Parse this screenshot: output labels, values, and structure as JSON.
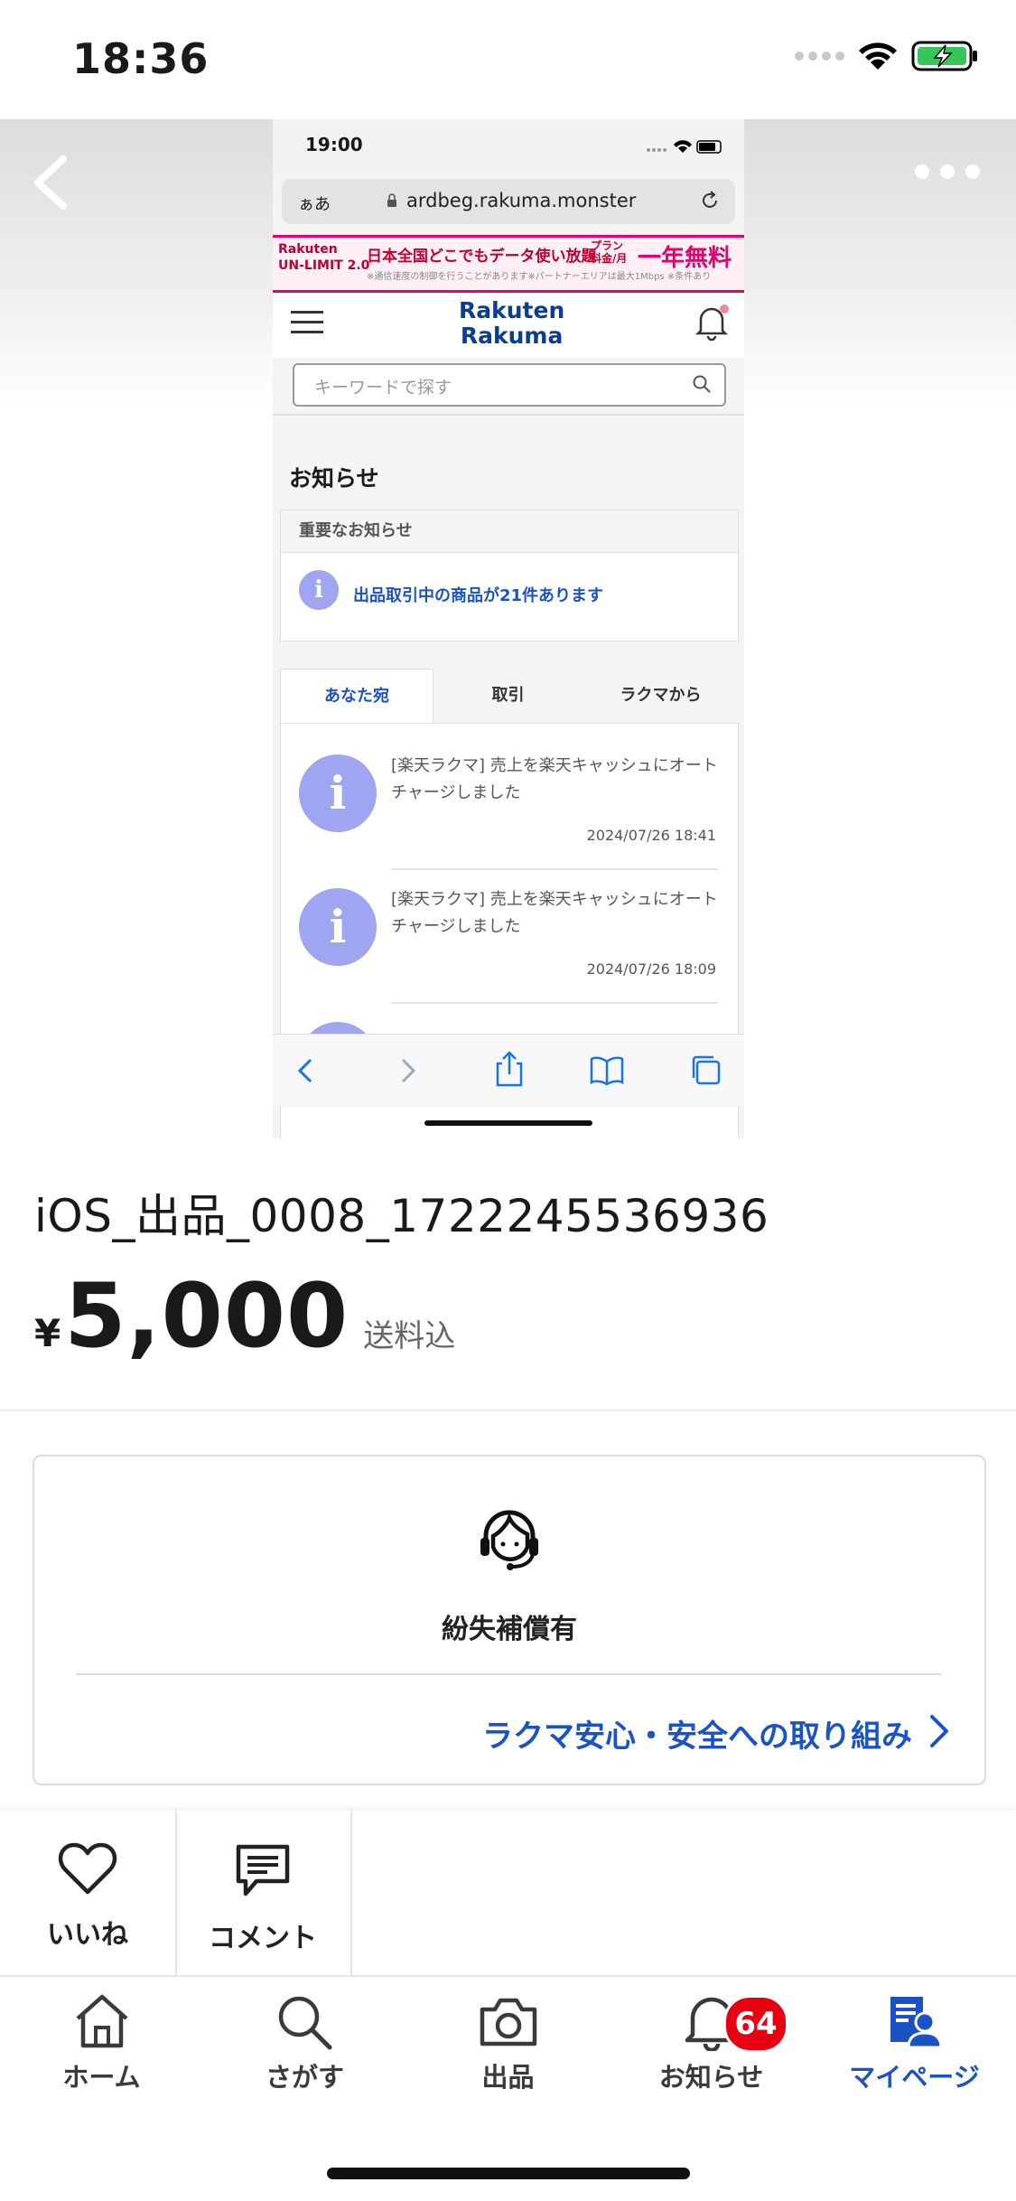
{
  "status_bar": {
    "time": "18:36"
  },
  "hero": {
    "screenshot": {
      "time": "19:00",
      "url_prefix": "ぁあ",
      "url": "ardbeg.rakuma.monster",
      "ad": {
        "brand_line1": "Rakuten",
        "brand_line2": "UN-LIMIT 2.0",
        "main": "日本全国どこでもデータ使い放題",
        "plan_line1": "プラン",
        "plan_line2": "料金/月",
        "big": "一年無料",
        "fineprint": "※通信速度の制御を行うことがあります※パートナーエリアは最大1Mbps ※条件あり"
      },
      "logo_line1": "Rakuten",
      "logo_line2": "Rakuma",
      "search_placeholder": "キーワードで探す",
      "page_title": "お知らせ",
      "important_header": "重要なお知らせ",
      "important_text": "出品取引中の商品が21件あります",
      "tabs": [
        "あなた宛",
        "取引",
        "ラクマから"
      ],
      "notifications": [
        {
          "line1": "[楽天ラクマ] 売上を楽天キャッシュにオート",
          "line2": "チャージしました",
          "date": "2024/07/26 18:41"
        },
        {
          "line1": "[楽天ラクマ] 売上を楽天キャッシュにオート",
          "line2": "チャージしました",
          "date": "2024/07/26 18:09"
        }
      ]
    }
  },
  "product": {
    "title": "iOS_出品_0008_1722245536936",
    "currency": "¥",
    "price": "5,000",
    "shipping": "送料込"
  },
  "safety": {
    "label": "紛失補償有",
    "link": "ラクマ安心・安全への取り組み"
  },
  "actions": {
    "like": "いいね",
    "comment": "コメント"
  },
  "tab_bar": {
    "home": "ホーム",
    "search": "さがす",
    "sell": "出品",
    "notifications": "お知らせ",
    "notifications_badge": "64",
    "mypage": "マイページ"
  },
  "colors": {
    "accent": "#1c53c4",
    "badge": "#e60012",
    "info": "#9fa5f0"
  }
}
